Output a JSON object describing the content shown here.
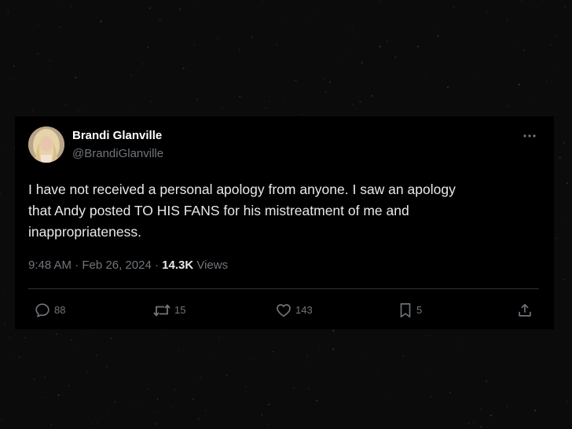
{
  "tweet": {
    "author": {
      "display_name": "Brandi Glanville",
      "handle": "@BrandiGlanville"
    },
    "text": "I have not received a personal apology from anyone. I saw an apology\nthat Andy posted  TO HIS FANS for his mistreatment of me and\ninappropriateness.",
    "meta": {
      "time": "9:48 AM",
      "separator_1": " · ",
      "date": "Feb 26, 2024",
      "separator_2": " · ",
      "views_count": "14.3K",
      "views_label": " Views"
    },
    "actions": {
      "reply_count": "88",
      "retweet_count": "15",
      "like_count": "143",
      "bookmark_count": "5"
    },
    "icons": {
      "more": "ellipsis-icon",
      "reply": "speech-bubble-icon",
      "retweet": "retweet-arrows-icon",
      "like": "heart-icon",
      "bookmark": "bookmark-icon",
      "share": "share-upload-icon"
    }
  },
  "colors": {
    "background": "#0a0a0a",
    "card": "#000000",
    "primary_text": "#e7e9ea",
    "secondary_text": "#71767b",
    "divider": "#2f3336"
  }
}
